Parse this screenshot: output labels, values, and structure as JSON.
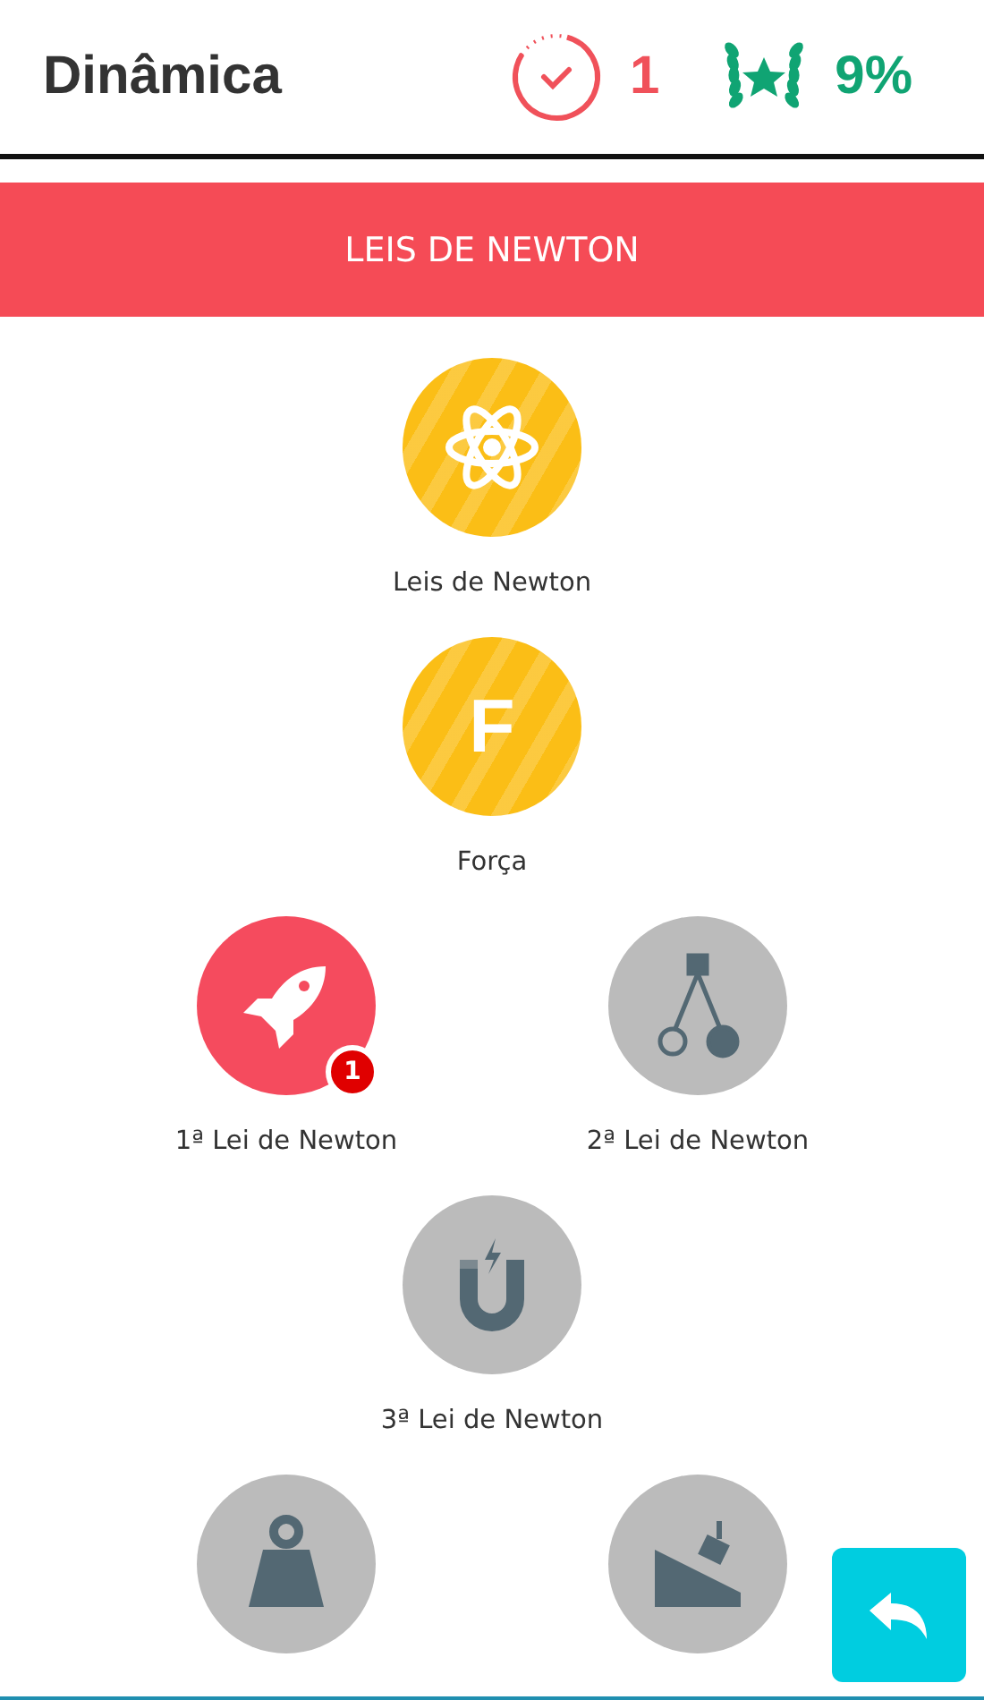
{
  "header": {
    "title": "Dinâmica",
    "progress": {
      "count": "1"
    },
    "score": "9%"
  },
  "section": {
    "title": "LEIS DE NEWTON"
  },
  "rows": [
    {
      "nodes": [
        {
          "label": "Leis de Newton",
          "completed": true,
          "locked": false,
          "kind": "atom"
        }
      ]
    },
    {
      "nodes": [
        {
          "label": "Força",
          "completed": true,
          "locked": false,
          "kind": "letter",
          "glyph": "F"
        }
      ]
    },
    {
      "nodes": [
        {
          "label": "1ª Lei de Newton",
          "completed": false,
          "locked": false,
          "kind": "rocket",
          "badge": "1"
        },
        {
          "label": "2ª Lei de Newton",
          "completed": false,
          "locked": true,
          "kind": "pendulum"
        }
      ]
    },
    {
      "nodes": [
        {
          "label": "3ª Lei de Newton",
          "completed": false,
          "locked": true,
          "kind": "magnet"
        }
      ]
    },
    {
      "nodes": [
        {
          "completed": false,
          "locked": true,
          "kind": "weight"
        },
        {
          "completed": false,
          "locked": true,
          "kind": "ramp"
        }
      ]
    }
  ]
}
